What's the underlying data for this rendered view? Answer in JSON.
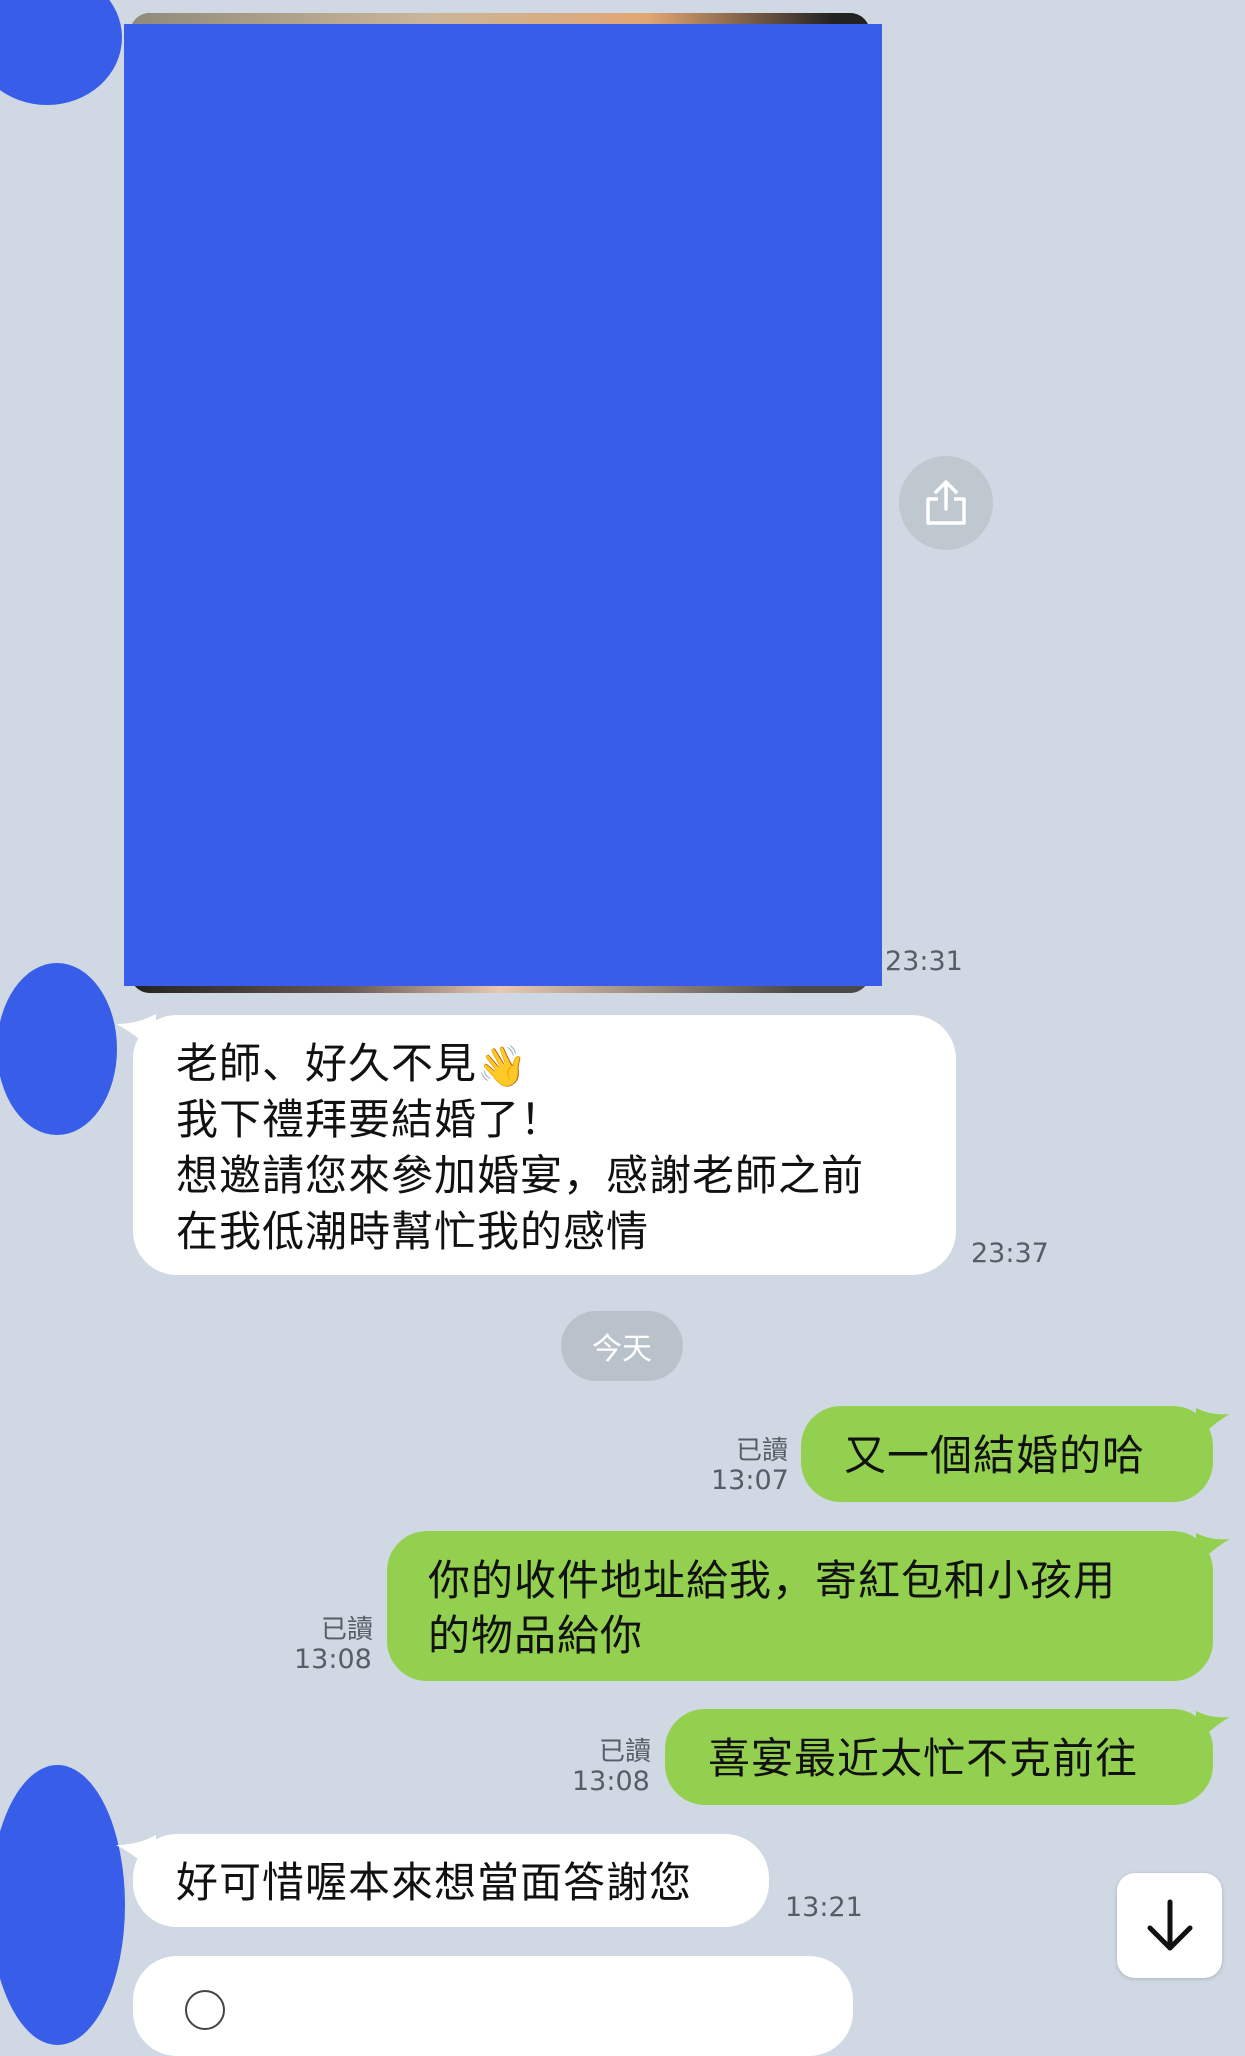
{
  "messages": {
    "photo_time": "23:31",
    "invite": {
      "line1": "老師、好久不見",
      "wave_icon": "👋",
      "line2": "我下禮拜要結婚了！",
      "line3": "想邀請您來參加婚宴，感謝老師之前",
      "line4": "在我低潮時幫忙我的感情",
      "time": "23:37"
    },
    "date_separator": "今天",
    "out1": {
      "text": "又一個結婚的哈",
      "read": "已讀",
      "time": "13:07"
    },
    "out2": {
      "line1": "你的收件地址給我，寄紅包和小孩用",
      "line2": "的物品給你",
      "read": "已讀",
      "time": "13:08"
    },
    "out3": {
      "text": "喜宴最近太忙不克前往",
      "read": "已讀",
      "time": "13:08"
    },
    "in2": {
      "text": "好可惜喔本來想當面答謝您",
      "time": "13:21"
    }
  },
  "colors": {
    "background": "#d0d9e3",
    "incoming_bubble": "#ffffff",
    "outgoing_bubble": "#93d04f",
    "redaction": "#385de8"
  },
  "icons": {
    "share": "share-icon",
    "scroll_down": "arrow-down-icon"
  }
}
